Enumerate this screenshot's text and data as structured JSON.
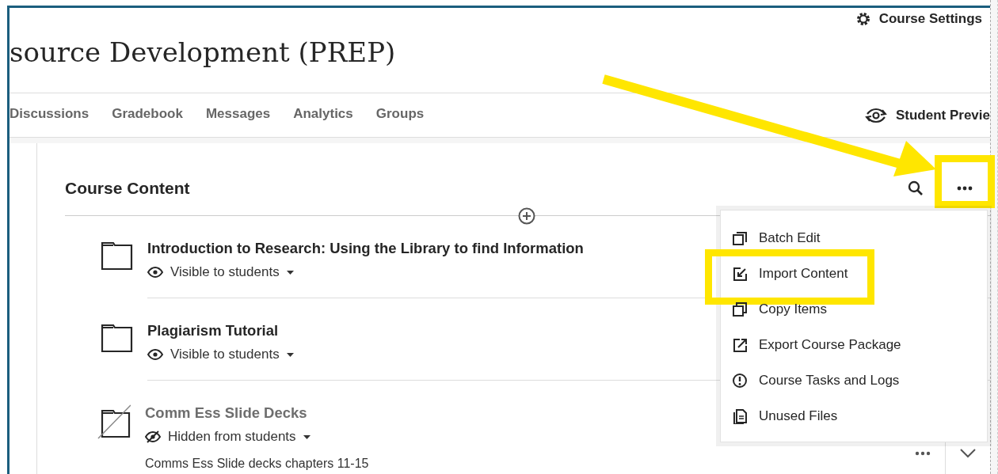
{
  "header": {
    "settings_label": "Course Settings",
    "course_title": "source Development (PREP)"
  },
  "nav": {
    "tabs": [
      {
        "label": "Discussions",
        "selected": false
      },
      {
        "label": "Gradebook",
        "selected": false
      },
      {
        "label": "Messages",
        "selected": false
      },
      {
        "label": "Analytics",
        "selected": false
      },
      {
        "label": "Groups",
        "selected": false
      }
    ],
    "preview_label": "Student Previe"
  },
  "content": {
    "title": "Course Content",
    "more_highlighted": true,
    "items": [
      {
        "title": "Introduction to Research: Using the Library to find Information",
        "visible": true,
        "visibility": "Visible to students",
        "actions": false
      },
      {
        "title": "Plagiarism Tutorial",
        "visible": true,
        "visibility": "Visible to students",
        "actions": false
      },
      {
        "title": "Comm Ess Slide Decks",
        "visible": false,
        "visibility": "Hidden from students",
        "description": "Comms Ess Slide decks chapters 11-15",
        "actions": true
      }
    ]
  },
  "menu": {
    "items": [
      {
        "kind": "batch",
        "label": "Batch Edit",
        "highlighted": false
      },
      {
        "kind": "import",
        "label": "Import Content",
        "highlighted": true
      },
      {
        "kind": "copy",
        "label": "Copy Items",
        "highlighted": false
      },
      {
        "kind": "export",
        "label": "Export Course Package",
        "highlighted": false
      },
      {
        "kind": "tasks",
        "label": "Course Tasks and Logs",
        "highlighted": false
      },
      {
        "kind": "files",
        "label": "Unused Files",
        "highlighted": false
      }
    ]
  }
}
